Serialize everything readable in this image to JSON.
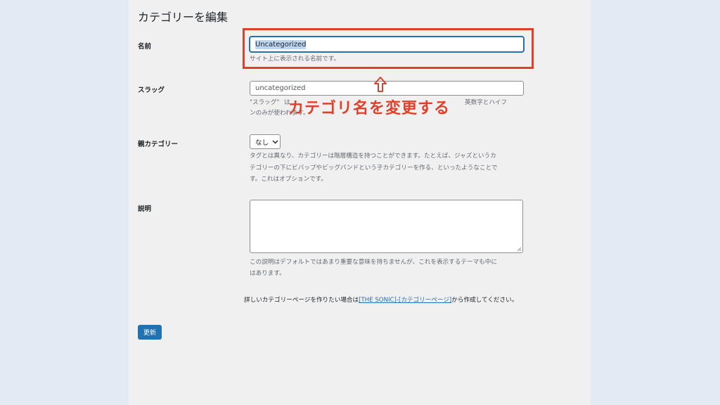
{
  "page": {
    "title": "カテゴリーを編集"
  },
  "form": {
    "name": {
      "label": "名前",
      "value": "Uncategorized",
      "help": "サイト上に表示される名前です。"
    },
    "slug": {
      "label": "スラッグ",
      "value": "uncategorized",
      "help_line1_a": "\"スラッグ\"",
      "help_line1_b": "は",
      "help_line1_c": "英数字とハイフ",
      "help_line2": "ンのみが使われます。"
    },
    "parent": {
      "label": "親カテゴリー",
      "selected": "なし",
      "help_line1": "タグとは異なり、カテゴリーは階層構造を持つことができます。たとえば、ジャズというカ",
      "help_line2": "テゴリーの下にビバップやビッグバンドという子カテゴリーを作る、といったようなことで",
      "help_line3": "す。これはオプションです。"
    },
    "description": {
      "label": "説明",
      "value": "",
      "help_line1": "この説明はデフォルトではあまり重要な意味を持ちませんが、これを表示するテーマも中に",
      "help_line2": "はあります。"
    }
  },
  "notice": {
    "before": "詳しいカテゴリーページを作りたい場合は",
    "link": "[THE SONIC]-[カテゴリーページ]",
    "after": "から作成してください。"
  },
  "buttons": {
    "update": "更新"
  },
  "annotation": {
    "text": "カテゴリ名を変更する",
    "color": "#e0402a"
  }
}
